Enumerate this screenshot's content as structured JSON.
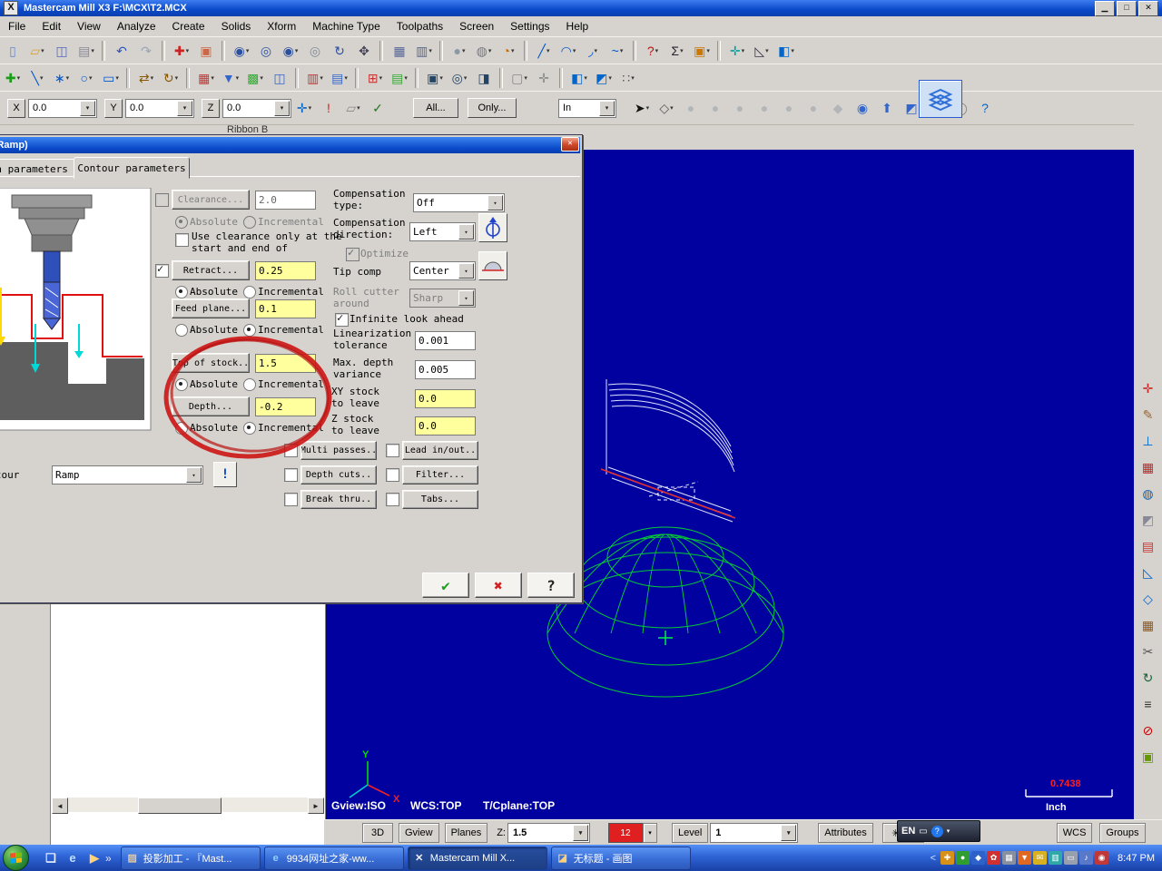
{
  "titlebar": {
    "title": "Mastercam Mill X3  F:\\MCX\\T2.MCX",
    "min_glyph": "▁",
    "restore_glyph": "□",
    "close_glyph": "✕",
    "app_glyph": "X"
  },
  "menubar": {
    "items": [
      "File",
      "Edit",
      "View",
      "Analyze",
      "Create",
      "Solids",
      "Xform",
      "Machine Type",
      "Toolpaths",
      "Screen",
      "Settings",
      "Help"
    ]
  },
  "ribbon_label": "Ribbon B",
  "toolbar_row1": [
    {
      "n": "new-file",
      "g": "▯",
      "c": "#6688cc"
    },
    {
      "n": "open-file",
      "g": "▱",
      "c": "#d8a23a",
      "caret": true
    },
    {
      "n": "save-file",
      "g": "◫",
      "c": "#5566bb"
    },
    {
      "n": "print",
      "g": "▤",
      "c": "#889",
      "caret": true
    },
    {
      "sep": true
    },
    {
      "n": "undo",
      "g": "↶",
      "c": "#2a52be"
    },
    {
      "n": "redo",
      "g": "↷",
      "c": "#98a2b8"
    },
    {
      "sep": true
    },
    {
      "n": "delete-entity",
      "g": "✚",
      "c": "#cc2222",
      "caret": true
    },
    {
      "n": "undelete-entity",
      "g": "▣",
      "c": "#cc6644"
    },
    {
      "sep": true
    },
    {
      "n": "zoom-window",
      "g": "◉",
      "c": "#2b4fa0",
      "caret": true
    },
    {
      "n": "zoom-target",
      "g": "◎",
      "c": "#2b4fa0"
    },
    {
      "n": "zoom-selected",
      "g": "◉",
      "c": "#2b4fa0",
      "caret": true
    },
    {
      "n": "unzoom",
      "g": "◎",
      "c": "#808a98"
    },
    {
      "n": "dynamic-rotate",
      "g": "↻",
      "c": "#2b4fa0"
    },
    {
      "n": "pan",
      "g": "✥",
      "c": "#445"
    },
    {
      "sep": true
    },
    {
      "n": "repaint",
      "g": "▦",
      "c": "#556699"
    },
    {
      "n": "viewsheet",
      "g": "▥",
      "c": "#556699",
      "caret": true
    },
    {
      "sep": true
    },
    {
      "n": "shaded-view",
      "g": "●",
      "c": "#8a98a8",
      "caret": true
    },
    {
      "n": "wireframe-view",
      "g": "◍",
      "c": "#778",
      "caret": true
    },
    {
      "n": "orient-view",
      "g": "◔",
      "c": "#cc6600",
      "caret": true
    },
    {
      "sep": true
    },
    {
      "n": "create-line",
      "g": "╱",
      "c": "#0055cc",
      "caret": true
    },
    {
      "n": "create-arc",
      "g": "◠",
      "c": "#0055cc",
      "caret": true
    },
    {
      "n": "create-fillet",
      "g": "◞",
      "c": "#0055cc",
      "caret": true
    },
    {
      "n": "create-spline",
      "g": "~",
      "c": "#0055cc",
      "caret": true
    },
    {
      "sep": true
    },
    {
      "n": "help",
      "g": "?",
      "c": "#bb1111",
      "caret": true
    },
    {
      "n": "notes",
      "g": "Σ",
      "c": "#223",
      "caret": true
    },
    {
      "n": "screen-capture",
      "g": "▣",
      "c": "#cc7700",
      "caret": true
    },
    {
      "sep": true
    },
    {
      "n": "axes-toggle",
      "g": "✛",
      "c": "#00a0a0",
      "caret": true
    },
    {
      "n": "measure",
      "g": "◺",
      "c": "#334",
      "caret": true
    },
    {
      "n": "view-orientation",
      "g": "◧",
      "c": "#0066cc",
      "caret": true
    }
  ],
  "toolbar_row2": [
    {
      "n": "analyze-entity",
      "g": "✚",
      "c": "#1a9e1a",
      "caret": true
    },
    {
      "n": "analyze-distance",
      "g": "╲",
      "c": "#0055cc",
      "caret": true
    },
    {
      "n": "create-point",
      "g": "∗",
      "c": "#0055cc",
      "caret": true
    },
    {
      "n": "create-circle",
      "g": "○",
      "c": "#0055cc",
      "caret": true
    },
    {
      "n": "create-rect",
      "g": "▭",
      "c": "#0055cc",
      "caret": true
    },
    {
      "sep": true
    },
    {
      "n": "xform-translate",
      "g": "⇄",
      "c": "#885500",
      "caret": true
    },
    {
      "n": "xform-rotate",
      "g": "↻",
      "c": "#885500",
      "caret": true
    },
    {
      "sep": true
    },
    {
      "n": "toolpath-contour",
      "g": "▦",
      "c": "#cc3333",
      "caret": true
    },
    {
      "n": "toolpath-drill",
      "g": "▼",
      "c": "#3366cc",
      "caret": true
    },
    {
      "n": "toolpath-pocket",
      "g": "▩",
      "c": "#33aa33",
      "caret": true
    },
    {
      "n": "toolpath-face",
      "g": "◫",
      "c": "#3366cc"
    },
    {
      "sep": true
    },
    {
      "n": "operations-manager",
      "g": "▥",
      "c": "#cc3333",
      "caret": true
    },
    {
      "n": "backplot",
      "g": "▤",
      "c": "#3366cc",
      "caret": true
    },
    {
      "sep": true
    },
    {
      "n": "verify",
      "g": "⊞",
      "c": "#cc3333",
      "caret": true
    },
    {
      "n": "post-process",
      "g": "▤",
      "c": "#33aa33",
      "caret": true
    },
    {
      "sep": true
    },
    {
      "n": "machine-mill",
      "g": "▣",
      "c": "#224466",
      "caret": true
    },
    {
      "n": "machine-lathe",
      "g": "◎",
      "c": "#224466",
      "caret": true
    },
    {
      "n": "machine-router",
      "g": "◨",
      "c": "#224466"
    },
    {
      "sep": true
    },
    {
      "n": "stock-setup",
      "g": "▢",
      "c": "#888",
      "caret": true
    },
    {
      "n": "tool-settings",
      "g": "✛",
      "c": "#888"
    },
    {
      "sep": true
    },
    {
      "n": "planes-menu",
      "g": "◧",
      "c": "#0066cc",
      "caret": true
    },
    {
      "n": "wcs-menu",
      "g": "◩",
      "c": "#0066cc",
      "caret": true
    },
    {
      "n": "grid-settings",
      "g": "∷",
      "c": "#555",
      "caret": true
    }
  ],
  "autocursor": {
    "x_label": "X",
    "x_value": "0.0",
    "y_label": "Y",
    "y_value": "0.0",
    "z_label": "Z",
    "z_value": "0.0",
    "all_label": "All...",
    "only_label": "Only...",
    "in_value": "In",
    "pre_icons": [
      {
        "n": "autocursor-config",
        "g": "✛",
        "c": "#0066cc",
        "caret": true
      },
      {
        "n": "fastpoint",
        "g": "!",
        "c": "#cc2222"
      },
      {
        "n": "cursor-grid",
        "g": "▱",
        "c": "#888",
        "caret": true
      },
      {
        "n": "cursor-check",
        "g": "✓",
        "c": "#227722"
      }
    ],
    "post_icons": [
      {
        "n": "selection-arrow",
        "g": "➤",
        "c": "#111",
        "caret": true
      },
      {
        "n": "select-window",
        "g": "◇",
        "c": "#555",
        "caret": true
      },
      {
        "n": "snap-a",
        "g": "●",
        "c": "#98a0a8",
        "dis": true
      },
      {
        "n": "snap-b",
        "g": "●",
        "c": "#98a0a8",
        "dis": true
      },
      {
        "n": "snap-c",
        "g": "●",
        "c": "#98a0a8",
        "dis": true
      },
      {
        "n": "snap-d",
        "g": "●",
        "c": "#98a0a8",
        "dis": true
      },
      {
        "n": "snap-e",
        "g": "●",
        "c": "#98a0a8",
        "dis": true
      },
      {
        "n": "snap-f",
        "g": "●",
        "c": "#98a0a8",
        "dis": true
      },
      {
        "n": "snap-diamond",
        "g": "◆",
        "c": "#98a0a8",
        "dis": true
      },
      {
        "n": "select-last",
        "g": "◉",
        "c": "#3366cc"
      },
      {
        "n": "select-all",
        "g": "⬆",
        "c": "#3366cc"
      },
      {
        "n": "select-verify",
        "g": "◩",
        "c": "#3366cc"
      },
      {
        "n": "select-invalid",
        "g": "⊘",
        "c": "#888"
      },
      {
        "n": "select-result",
        "g": "◯",
        "c": "#888"
      },
      {
        "n": "select-help",
        "g": "?",
        "c": "#0066cc"
      }
    ]
  },
  "rstrip_icons": [
    {
      "n": "mru-analyze",
      "g": "✛",
      "c": "#cc2222"
    },
    {
      "n": "mru-sketch",
      "g": "✎",
      "c": "#996633"
    },
    {
      "n": "mru-trim",
      "g": "⊥",
      "c": "#0066cc"
    },
    {
      "n": "mru-toolpath",
      "g": "▦",
      "c": "#cc2222"
    },
    {
      "n": "mru-sphere",
      "g": "◍",
      "c": "#0066cc"
    },
    {
      "n": "mru-surface",
      "g": "◩",
      "c": "#889"
    },
    {
      "n": "mru-grid",
      "g": "▤",
      "c": "#cc3333"
    },
    {
      "n": "mru-measure",
      "g": "◺",
      "c": "#0066cc"
    },
    {
      "n": "mru-diamond",
      "g": "◇",
      "c": "#0066cc"
    },
    {
      "n": "mru-block",
      "g": "▦",
      "c": "#995511"
    },
    {
      "n": "mru-trim2",
      "g": "✂",
      "c": "#555"
    },
    {
      "n": "mru-rotate",
      "g": "↻",
      "c": "#116633"
    },
    {
      "n": "mru-list",
      "g": "≡",
      "c": "#333"
    },
    {
      "n": "mru-delete",
      "g": "⊘",
      "c": "#cc0000"
    },
    {
      "n": "mru-shade",
      "g": "▣",
      "c": "#669900"
    }
  ],
  "dialog": {
    "title": "Contour (Ramp)",
    "close_glyph": "✕",
    "tab_toolpath": "Toolpath parameters",
    "tab_contour": "Contour parameters",
    "clearance_label": "Clearance...",
    "clearance_value": "2.0",
    "abs_label": "Absolute",
    "inc_label": "Incremental",
    "use_clearance_label": "Use clearance only at the\nstart and end of",
    "retract_label": "Retract...",
    "retract_value": "0.25",
    "feed_label": "Feed plane...",
    "feed_value": "0.1",
    "top_stock_label": "Top of stock..",
    "top_stock_value": "1.5",
    "depth_label": "Depth...",
    "depth_value": "-0.2",
    "comp_type_label": "Compensation\ntype:",
    "comp_type_value": "Off",
    "comp_dir_label": "Compensation\ndirection:",
    "comp_dir_value": "Left",
    "optimize_label": "Optimize",
    "tip_comp_label": "Tip comp",
    "tip_comp_value": "Center",
    "roll_label": "Roll cutter\naround",
    "roll_value": "Sharp",
    "infinite_label": "Infinite look ahead",
    "linearization_label": "Linearization\ntolerance",
    "linearization_value": "0.001",
    "max_depth_label": "Max. depth\nvariance",
    "max_depth_value": "0.005",
    "xy_stock_label": "XY stock\nto leave",
    "xy_stock_value": "0.0",
    "z_stock_label": "Z stock\nto leave",
    "z_stock_value": "0.0",
    "contour_label": "Contour",
    "contour_value": "Ramp",
    "warn_glyph": "!",
    "multi_label": "Multi passes..",
    "lead_label": "Lead in/out..",
    "depth_cuts_label": "Depth cuts..",
    "filter_label": "Filter...",
    "break_label": "Break thru..",
    "tabs_label": "Tabs...",
    "ok_glyph": "✔",
    "cancel_glyph": "✖",
    "help_glyph": "?"
  },
  "graphics": {
    "gview_label": "Gview:ISO",
    "wcs_label": "WCS:TOP",
    "cplane_label": "T/Cplane:TOP",
    "scale_value": "0.7438",
    "unit_label": "Inch",
    "axis_x": "X",
    "axis_y": "Y"
  },
  "statusbar": {
    "btn_3d": "3D",
    "gview": "Gview",
    "planes": "Planes",
    "z_label": "Z:",
    "z_value": "1.5",
    "color_value": "12",
    "level_label": "Level",
    "level_value": "1",
    "attributes": "Attributes",
    "star_glyph": "✳",
    "wcs": "WCS",
    "groups": "Groups"
  },
  "ime": {
    "lang": "EN",
    "kb_glyph": "▭",
    "help_glyph": "?"
  },
  "taskbar": {
    "time": "8:47 PM",
    "more_glyph": "»",
    "collapse_glyph": "<",
    "quicklaunch": [
      {
        "n": "show-desktop",
        "g": "❏",
        "c": "#e8f0ff"
      },
      {
        "n": "internet-explorer",
        "g": "e",
        "c": "#bfe0ff"
      },
      {
        "n": "media-player",
        "g": "▶",
        "c": "#ffd27a"
      }
    ],
    "tasks": [
      {
        "n": "projection-cam",
        "icon": "▨",
        "ic": "#e0c8a0",
        "label": "投影加工 - 『Mast..."
      },
      {
        "n": "ie-9934",
        "icon": "e",
        "ic": "#8fd0ff",
        "label": "9934网址之家-ww..."
      },
      {
        "n": "mastercam",
        "icon": "✕",
        "ic": "#f0f0f0",
        "label": "Mastercam Mill X...",
        "active": true
      },
      {
        "n": "paint",
        "icon": "◪",
        "ic": "#ffd27a",
        "label": "无标题 - 画图"
      }
    ],
    "tray": [
      {
        "n": "tray-security",
        "g": "✚",
        "c": "#d89018"
      },
      {
        "n": "tray-update",
        "g": "●",
        "c": "#2f9e2f"
      },
      {
        "n": "tray-messenger",
        "g": "◆",
        "c": "#2f62c8"
      },
      {
        "n": "tray-antivirus",
        "g": "✿",
        "c": "#d03030"
      },
      {
        "n": "tray-display",
        "g": "▦",
        "c": "#8890a0"
      },
      {
        "n": "tray-download",
        "g": "▼",
        "c": "#e06820"
      },
      {
        "n": "tray-mail",
        "g": "✉",
        "c": "#d8b020"
      },
      {
        "n": "tray-network",
        "g": "▥",
        "c": "#30a8a8"
      },
      {
        "n": "tray-input",
        "g": "▭",
        "c": "#98a0b0"
      },
      {
        "n": "tray-volume",
        "g": "♪",
        "c": "#5a78c8"
      },
      {
        "n": "tray-safety",
        "g": "◉",
        "c": "#c03838"
      }
    ]
  }
}
